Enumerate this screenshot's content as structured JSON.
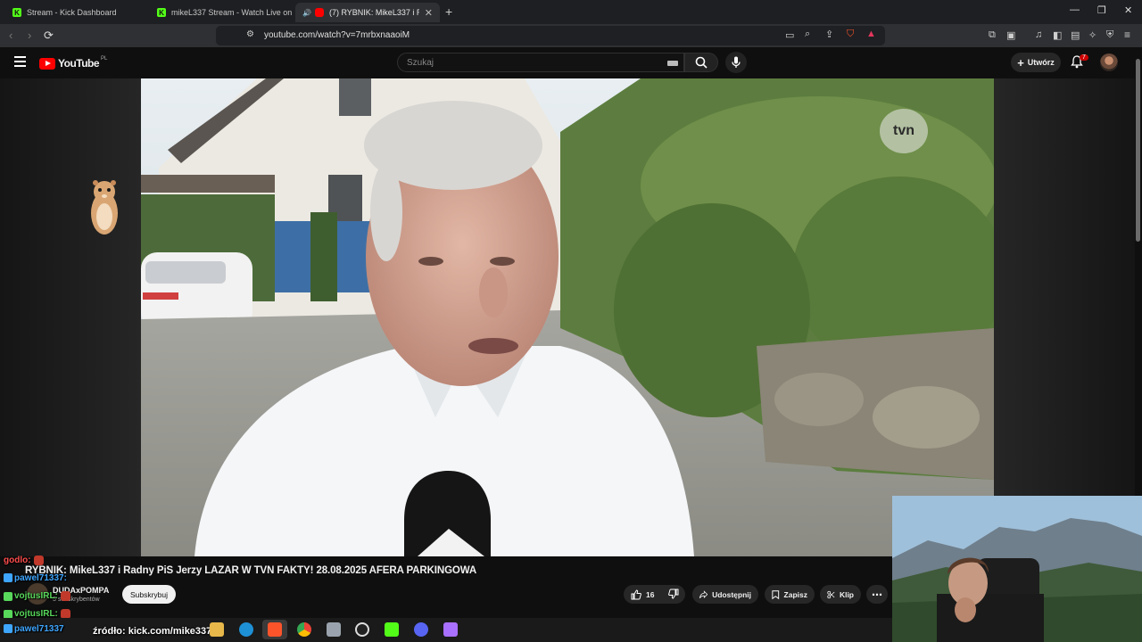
{
  "browser": {
    "tabs": [
      {
        "title": "Stream - Kick Dashboard",
        "active": false
      },
      {
        "title": "mikeL337 Stream - Watch Live on",
        "active": false
      },
      {
        "title": "(7) RYBNIK: MikeL337 i Radny",
        "active": true
      }
    ],
    "url": "youtube.com/watch?v=7mrbxnaaoiM"
  },
  "youtube": {
    "logo_text": "YouTube",
    "logo_region": "PL",
    "search_placeholder": "Szukaj",
    "create_label": "Utwórz",
    "notification_count": "7"
  },
  "video": {
    "watermark": "tvn",
    "title": "RYBNIK: MikeL337 i Radny PiS Jerzy LAZAR W TVN FAKTY! 28.08.2025 AFERA PARKINGOWA",
    "channel_name": "DUDAxPOMPA",
    "channel_subs": "3 subskrybentów",
    "subscribe_label": "Subskrybuj",
    "likes": "16",
    "share_label": "Udostępnij",
    "save_label": "Zapisz",
    "clip_label": "Klip"
  },
  "chat": [
    {
      "user": "godlo:",
      "color": "#ff4d4d"
    },
    {
      "user": "pawel71337:",
      "color": "#3ea6ff"
    },
    {
      "user": "vojtusIRL:",
      "color": "#58d95b"
    },
    {
      "user": "vojtusIRL:",
      "color": "#58d95b"
    },
    {
      "user": "pawel71337",
      "color": "#3ea6ff"
    }
  ],
  "overlay": {
    "source_text": "źródło: kick.com/mike337"
  },
  "colors": {
    "yt_red": "#ff0000",
    "kick_green": "#53fc18",
    "bg": "#0f0f0f"
  }
}
